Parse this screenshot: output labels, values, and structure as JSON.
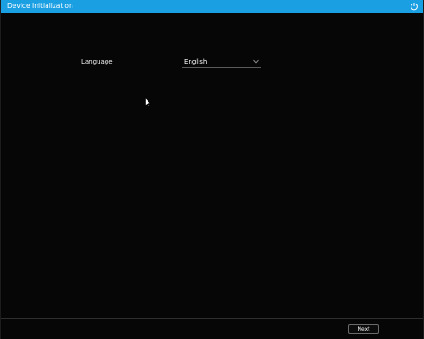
{
  "window": {
    "title": "Device Initialization",
    "titlebar_color": "#1a9fe3",
    "power_icon": "power-icon"
  },
  "language": {
    "label": "Language",
    "selected": "English",
    "dropdown_icon": "chevron-down-icon"
  },
  "footer": {
    "next_label": "Next"
  }
}
